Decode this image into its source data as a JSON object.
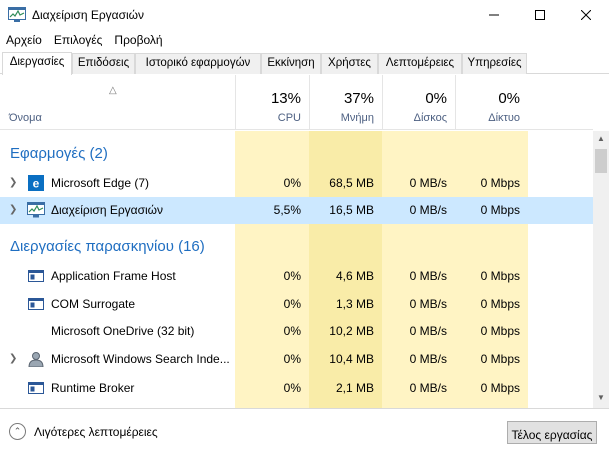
{
  "window": {
    "title": "Διαχείριση Εργασιών"
  },
  "menu": [
    "Αρχείο",
    "Επιλογές",
    "Προβολή"
  ],
  "tabs": [
    "Διεργασίες",
    "Επιδόσεις",
    "Ιστορικό εφαρμογών",
    "Εκκίνηση",
    "Χρήστες",
    "Λεπτομέρειες",
    "Υπηρεσίες"
  ],
  "active_tab": "Διεργασίες",
  "columns": {
    "name": {
      "label": "Όνομα"
    },
    "cpu": {
      "pct": "13%",
      "label": "CPU"
    },
    "memory": {
      "pct": "37%",
      "label": "Μνήμη"
    },
    "disk": {
      "pct": "0%",
      "label": "Δίσκος"
    },
    "network": {
      "pct": "0%",
      "label": "Δίκτυο"
    }
  },
  "groups": {
    "apps": "Εφαρμογές (2)",
    "background": "Διεργασίες παρασκηνίου (16)"
  },
  "rows": [
    {
      "name": "Microsoft Edge (7)",
      "icon": "edge-icon",
      "expandable": true,
      "cpu": "0%",
      "memory": "68,5 MB",
      "disk": "0 MB/s",
      "network": "0 Mbps"
    },
    {
      "name": "Διαχείριση Εργασιών",
      "icon": "task-manager-icon",
      "expandable": true,
      "selected": true,
      "cpu": "5,5%",
      "memory": "16,5 MB",
      "disk": "0 MB/s",
      "network": "0 Mbps"
    },
    {
      "name": "Application Frame Host",
      "icon": "window-icon",
      "expandable": false,
      "cpu": "0%",
      "memory": "4,6 MB",
      "disk": "0 MB/s",
      "network": "0 Mbps"
    },
    {
      "name": "COM Surrogate",
      "icon": "window-icon",
      "expandable": false,
      "cpu": "0%",
      "memory": "1,3 MB",
      "disk": "0 MB/s",
      "network": "0 Mbps"
    },
    {
      "name": "Microsoft OneDrive (32 bit)",
      "icon": "",
      "expandable": false,
      "cpu": "0%",
      "memory": "10,2 MB",
      "disk": "0 MB/s",
      "network": "0 Mbps"
    },
    {
      "name": "Microsoft Windows Search Inde...",
      "icon": "search-indexer-icon",
      "expandable": true,
      "cpu": "0%",
      "memory": "10,4 MB",
      "disk": "0 MB/s",
      "network": "0 Mbps"
    },
    {
      "name": "Runtime Broker",
      "icon": "window-icon",
      "expandable": false,
      "cpu": "0%",
      "memory": "2,1 MB",
      "disk": "0 MB/s",
      "network": "0 Mbps"
    }
  ],
  "footer": {
    "fewer_details": "Λιγότερες λεπτομέρειες",
    "end_task": "Τέλος εργασίας"
  },
  "colors": {
    "heat_light": "#fff4c4",
    "heat_mem": "#f9eca8",
    "group_text": "#1f6ec1",
    "selected_row": "#cce8ff"
  }
}
